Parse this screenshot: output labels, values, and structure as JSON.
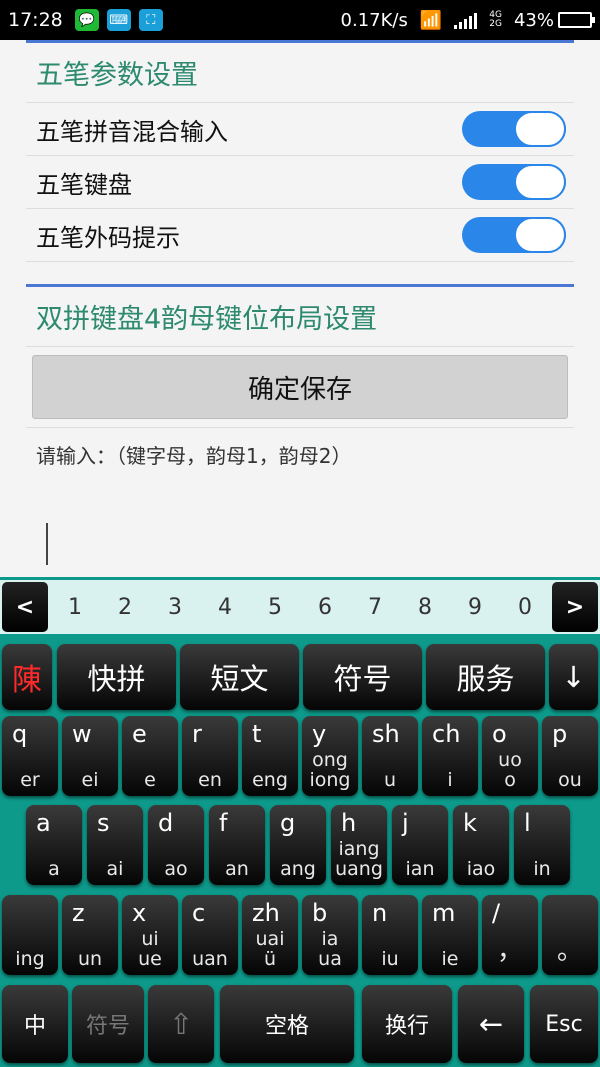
{
  "status_bar": {
    "time": "17:28",
    "speed": "0.17K/s",
    "network": [
      "4G",
      "2G"
    ],
    "battery": "43%",
    "battery_level": 0.43
  },
  "settings": {
    "wubi_title": "五笔参数设置",
    "rows": [
      {
        "label": "五笔拼音混合输入",
        "on": true
      },
      {
        "label": "五笔键盘",
        "on": true
      },
      {
        "label": "五笔外码提示",
        "on": true
      }
    ],
    "shuangpin_title": "双拼键盘4韵母键位布局设置",
    "save_label": "确定保存",
    "hint": "请输入：（键字母，韵母1，韵母2）"
  },
  "keyboard": {
    "left_arrow": "<",
    "right_arrow": ">",
    "digits": [
      "1",
      "2",
      "3",
      "4",
      "5",
      "6",
      "7",
      "8",
      "9",
      "0"
    ],
    "func_row": {
      "logo": "陳",
      "kuaipin": "快拼",
      "duanwen": "短文",
      "fuhao": "符号",
      "fuwu": "服务",
      "down": "↓"
    },
    "row1": [
      {
        "top": "q",
        "bot": "er"
      },
      {
        "top": "w",
        "bot": "ei"
      },
      {
        "top": "e",
        "bot": "e"
      },
      {
        "top": "r",
        "bot": "en"
      },
      {
        "top": "t",
        "bot": "eng"
      },
      {
        "top": "y",
        "bot": "ong\niong"
      },
      {
        "top": "sh",
        "bot": "u"
      },
      {
        "top": "ch",
        "bot": "i"
      },
      {
        "top": "o",
        "bot": "uo\no"
      },
      {
        "top": "p",
        "bot": "ou"
      }
    ],
    "row2": [
      {
        "top": "a",
        "bot": "a"
      },
      {
        "top": "s",
        "bot": "ai"
      },
      {
        "top": "d",
        "bot": "ao"
      },
      {
        "top": "f",
        "bot": "an"
      },
      {
        "top": "g",
        "bot": "ang"
      },
      {
        "top": "h",
        "bot": "iang\nuang"
      },
      {
        "top": "j",
        "bot": "ian"
      },
      {
        "top": "k",
        "bot": "iao"
      },
      {
        "top": "l",
        "bot": "in"
      }
    ],
    "row3": [
      {
        "top": "",
        "bot": "ing"
      },
      {
        "top": "z",
        "bot": "un"
      },
      {
        "top": "x",
        "bot": "ui\nue"
      },
      {
        "top": "c",
        "bot": "uan"
      },
      {
        "top": "zh",
        "bot": "uai\nü"
      },
      {
        "top": "b",
        "bot": "ia\nua"
      },
      {
        "top": "n",
        "bot": "iu"
      },
      {
        "top": "m",
        "bot": "ie"
      },
      {
        "top": "/",
        "bot": "，"
      },
      {
        "top": "",
        "bot": "。"
      }
    ],
    "bottom_row": {
      "zhong": "中",
      "fuhao": "符号",
      "shift": "⇧",
      "space": "空格",
      "enter": "换行",
      "backspace": "←",
      "esc": "Esc"
    }
  }
}
